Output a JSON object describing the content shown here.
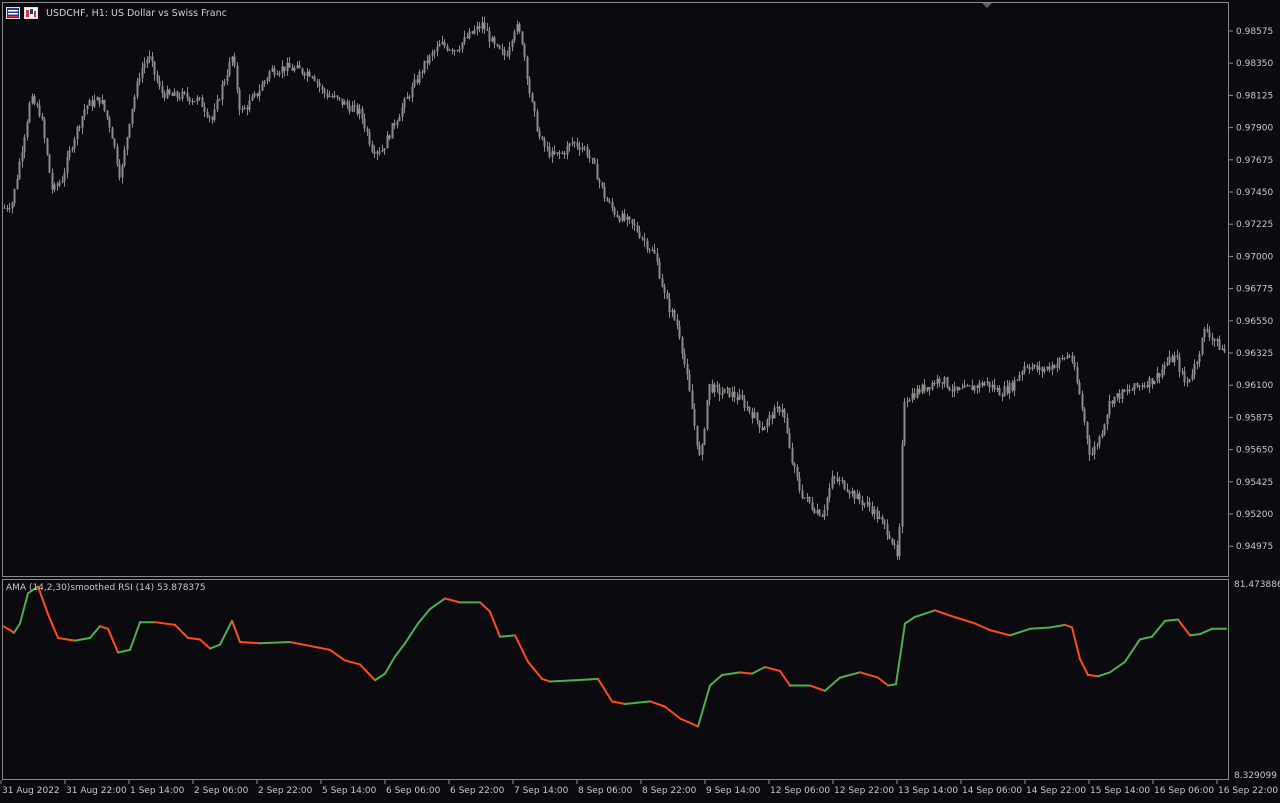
{
  "window": {
    "symbol_title": "USDCHF, H1:  US Dollar vs Swiss Franc"
  },
  "icons": [
    "chart-window-icon",
    "one-click-trading-icon"
  ],
  "indicator": {
    "title": "AMA (14,2,30)smoothed RSI (14) 53.878375",
    "scale_max": "81.473886",
    "scale_min": "8.329099"
  },
  "colors": {
    "background": "#0a0a0f",
    "candle": "#8c8c8c",
    "frame": "#8a8a8a",
    "rsi_up": "#4caf50",
    "rsi_down": "#ff4a1a"
  },
  "price_axis_labels": [
    "0.98575",
    "0.98350",
    "0.98125",
    "0.97900",
    "0.97675",
    "0.97450",
    "0.97225",
    "0.97000",
    "0.96775",
    "0.96550",
    "0.96325",
    "0.96100",
    "0.95875",
    "0.95650",
    "0.95425",
    "0.95200",
    "0.94975"
  ],
  "time_axis_labels": [
    "31 Aug 2022",
    "31 Aug 22:00",
    "1 Sep 14:00",
    "2 Sep 06:00",
    "2 Sep 22:00",
    "5 Sep 14:00",
    "6 Sep 06:00",
    "6 Sep 22:00",
    "7 Sep 14:00",
    "8 Sep 06:00",
    "8 Sep 22:00",
    "9 Sep 14:00",
    "12 Sep 06:00",
    "12 Sep 22:00",
    "13 Sep 14:00",
    "14 Sep 06:00",
    "14 Sep 22:00",
    "15 Sep 14:00",
    "16 Sep 06:00",
    "16 Sep 22:00"
  ],
  "chart_data": {
    "type": "candlestick",
    "title": "USDCHF, H1:  US Dollar vs Swiss Franc",
    "ylim": [
      0.948,
      0.9875
    ],
    "price_path": [
      [
        0,
        0.9732
      ],
      [
        12,
        0.9738
      ],
      [
        20,
        0.977
      ],
      [
        30,
        0.981
      ],
      [
        40,
        0.98
      ],
      [
        52,
        0.9745
      ],
      [
        62,
        0.9755
      ],
      [
        72,
        0.978
      ],
      [
        85,
        0.9805
      ],
      [
        100,
        0.981
      ],
      [
        110,
        0.979
      ],
      [
        120,
        0.9755
      ],
      [
        130,
        0.98
      ],
      [
        140,
        0.983
      ],
      [
        148,
        0.984
      ],
      [
        160,
        0.9815
      ],
      [
        170,
        0.9812
      ],
      [
        185,
        0.9812
      ],
      [
        200,
        0.9808
      ],
      [
        212,
        0.9795
      ],
      [
        222,
        0.982
      ],
      [
        232,
        0.984
      ],
      [
        240,
        0.98
      ],
      [
        255,
        0.9812
      ],
      [
        270,
        0.983
      ],
      [
        285,
        0.9832
      ],
      [
        300,
        0.983
      ],
      [
        312,
        0.9828
      ],
      [
        322,
        0.9815
      ],
      [
        335,
        0.981
      ],
      [
        348,
        0.9805
      ],
      [
        360,
        0.98
      ],
      [
        372,
        0.9775
      ],
      [
        382,
        0.9775
      ],
      [
        395,
        0.9795
      ],
      [
        410,
        0.9815
      ],
      [
        425,
        0.9835
      ],
      [
        440,
        0.9848
      ],
      [
        455,
        0.9845
      ],
      [
        470,
        0.9855
      ],
      [
        482,
        0.9862
      ],
      [
        495,
        0.9845
      ],
      [
        505,
        0.984
      ],
      [
        515,
        0.9862
      ],
      [
        522,
        0.985
      ],
      [
        530,
        0.981
      ],
      [
        540,
        0.978
      ],
      [
        552,
        0.977
      ],
      [
        562,
        0.9772
      ],
      [
        572,
        0.978
      ],
      [
        585,
        0.9775
      ],
      [
        595,
        0.976
      ],
      [
        605,
        0.974
      ],
      [
        615,
        0.973
      ],
      [
        625,
        0.9725
      ],
      [
        635,
        0.972
      ],
      [
        645,
        0.971
      ],
      [
        655,
        0.97
      ],
      [
        665,
        0.967
      ],
      [
        678,
        0.965
      ],
      [
        690,
        0.96
      ],
      [
        700,
        0.9555
      ],
      [
        708,
        0.961
      ],
      [
        718,
        0.9605
      ],
      [
        728,
        0.9605
      ],
      [
        740,
        0.96
      ],
      [
        752,
        0.959
      ],
      [
        762,
        0.958
      ],
      [
        772,
        0.959
      ],
      [
        782,
        0.9595
      ],
      [
        790,
        0.956
      ],
      [
        800,
        0.9535
      ],
      [
        812,
        0.9525
      ],
      [
        822,
        0.952
      ],
      [
        832,
        0.9545
      ],
      [
        845,
        0.954
      ],
      [
        858,
        0.953
      ],
      [
        870,
        0.9525
      ],
      [
        880,
        0.9515
      ],
      [
        890,
        0.9505
      ],
      [
        898,
        0.9485
      ],
      [
        903,
        0.96
      ],
      [
        915,
        0.9605
      ],
      [
        928,
        0.961
      ],
      [
        940,
        0.9615
      ],
      [
        955,
        0.9605
      ],
      [
        970,
        0.9608
      ],
      [
        985,
        0.9612
      ],
      [
        1000,
        0.9605
      ],
      [
        1012,
        0.961
      ],
      [
        1025,
        0.9625
      ],
      [
        1040,
        0.962
      ],
      [
        1055,
        0.9625
      ],
      [
        1070,
        0.9632
      ],
      [
        1080,
        0.96
      ],
      [
        1090,
        0.956
      ],
      [
        1100,
        0.9575
      ],
      [
        1110,
        0.96
      ],
      [
        1125,
        0.9605
      ],
      [
        1140,
        0.961
      ],
      [
        1155,
        0.9615
      ],
      [
        1165,
        0.9625
      ],
      [
        1175,
        0.963
      ],
      [
        1185,
        0.961
      ],
      [
        1195,
        0.9625
      ],
      [
        1205,
        0.965
      ],
      [
        1215,
        0.964
      ],
      [
        1226,
        0.9632
      ]
    ],
    "rsi_ylim": [
      8.329099,
      81.473886
    ],
    "rsi_path": [
      [
        4,
        65.4
      ],
      [
        14,
        63
      ],
      [
        20,
        66.5
      ],
      [
        28,
        78
      ],
      [
        38,
        80.5
      ],
      [
        48,
        70
      ],
      [
        58,
        61
      ],
      [
        75,
        60
      ],
      [
        90,
        61
      ],
      [
        100,
        65.5
      ],
      [
        108,
        64.5
      ],
      [
        118,
        55.5
      ],
      [
        130,
        56.5
      ],
      [
        140,
        67
      ],
      [
        155,
        67
      ],
      [
        175,
        66
      ],
      [
        188,
        61
      ],
      [
        200,
        60.5
      ],
      [
        210,
        57
      ],
      [
        220,
        58.5
      ],
      [
        232,
        67.5
      ],
      [
        240,
        59.5
      ],
      [
        260,
        59
      ],
      [
        290,
        59.5
      ],
      [
        310,
        58
      ],
      [
        330,
        56.5
      ],
      [
        345,
        52.5
      ],
      [
        360,
        51
      ],
      [
        375,
        45
      ],
      [
        385,
        47.5
      ],
      [
        395,
        54
      ],
      [
        405,
        59
      ],
      [
        418,
        66.5
      ],
      [
        430,
        72
      ],
      [
        445,
        76
      ],
      [
        460,
        74.5
      ],
      [
        480,
        74.5
      ],
      [
        490,
        71
      ],
      [
        500,
        61.5
      ],
      [
        515,
        62
      ],
      [
        528,
        52
      ],
      [
        542,
        45.5
      ],
      [
        550,
        44.5
      ],
      [
        575,
        45
      ],
      [
        598,
        45.5
      ],
      [
        612,
        37
      ],
      [
        625,
        36
      ],
      [
        650,
        37
      ],
      [
        665,
        35
      ],
      [
        680,
        30.5
      ],
      [
        698,
        27.5
      ],
      [
        710,
        43
      ],
      [
        722,
        47
      ],
      [
        740,
        48
      ],
      [
        752,
        47.5
      ],
      [
        765,
        50
      ],
      [
        780,
        48.5
      ],
      [
        790,
        43
      ],
      [
        810,
        43
      ],
      [
        825,
        41
      ],
      [
        840,
        46
      ],
      [
        860,
        48
      ],
      [
        878,
        46
      ],
      [
        888,
        43
      ],
      [
        896,
        43.5
      ],
      [
        905,
        66.5
      ],
      [
        915,
        69
      ],
      [
        935,
        71.5
      ],
      [
        950,
        69.5
      ],
      [
        975,
        66.5
      ],
      [
        990,
        64
      ],
      [
        1010,
        62
      ],
      [
        1030,
        64.5
      ],
      [
        1050,
        65
      ],
      [
        1065,
        66
      ],
      [
        1072,
        65
      ],
      [
        1080,
        53
      ],
      [
        1088,
        47
      ],
      [
        1098,
        46.5
      ],
      [
        1110,
        48
      ],
      [
        1125,
        52
      ],
      [
        1140,
        60.5
      ],
      [
        1152,
        61.5
      ],
      [
        1165,
        67.5
      ],
      [
        1178,
        68
      ],
      [
        1190,
        62
      ],
      [
        1200,
        62.5
      ],
      [
        1212,
        64.5
      ],
      [
        1226,
        64.5
      ]
    ]
  }
}
